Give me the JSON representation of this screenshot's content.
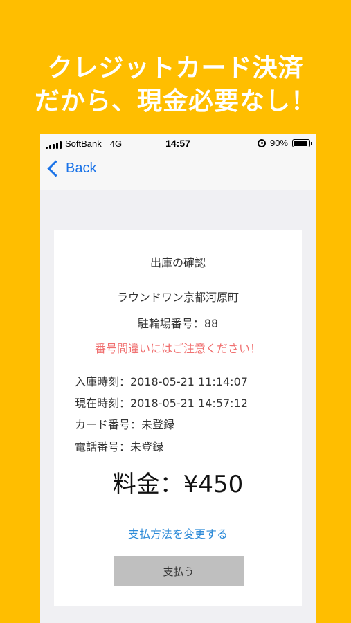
{
  "promo": {
    "line1": "クレジットカード決済",
    "line2": "だから、現金必要なし！"
  },
  "status_bar": {
    "carrier": "SoftBank",
    "network": "4G",
    "time": "14:57",
    "battery": "90%",
    "battery_level": 0.9,
    "icons": [
      "signal-icon",
      "orientation-lock-icon",
      "battery-icon"
    ]
  },
  "nav": {
    "back_label": "Back",
    "accent": "#1A73E8"
  },
  "card": {
    "title": "出庫の確認",
    "shop_name": "ラウンドワン京都河原町",
    "parking_number": "駐輪場番号：88",
    "warning": "番号間違いにはご注意ください！",
    "entry_time": "入庫時刻：2018-05-21 11:14:07",
    "current_time": "現在時刻：2018-05-21 14:57:12",
    "card_number": "カード番号：未登録",
    "phone_number": "電話番号：未登録",
    "fee": "料金：¥450",
    "change_payment_link": "支払方法を変更する",
    "pay_button": "支払う"
  },
  "colors": {
    "background": "#FFBE00",
    "warning": "#F07070",
    "link": "#2E8BD8",
    "button": "#BFBFBF"
  }
}
